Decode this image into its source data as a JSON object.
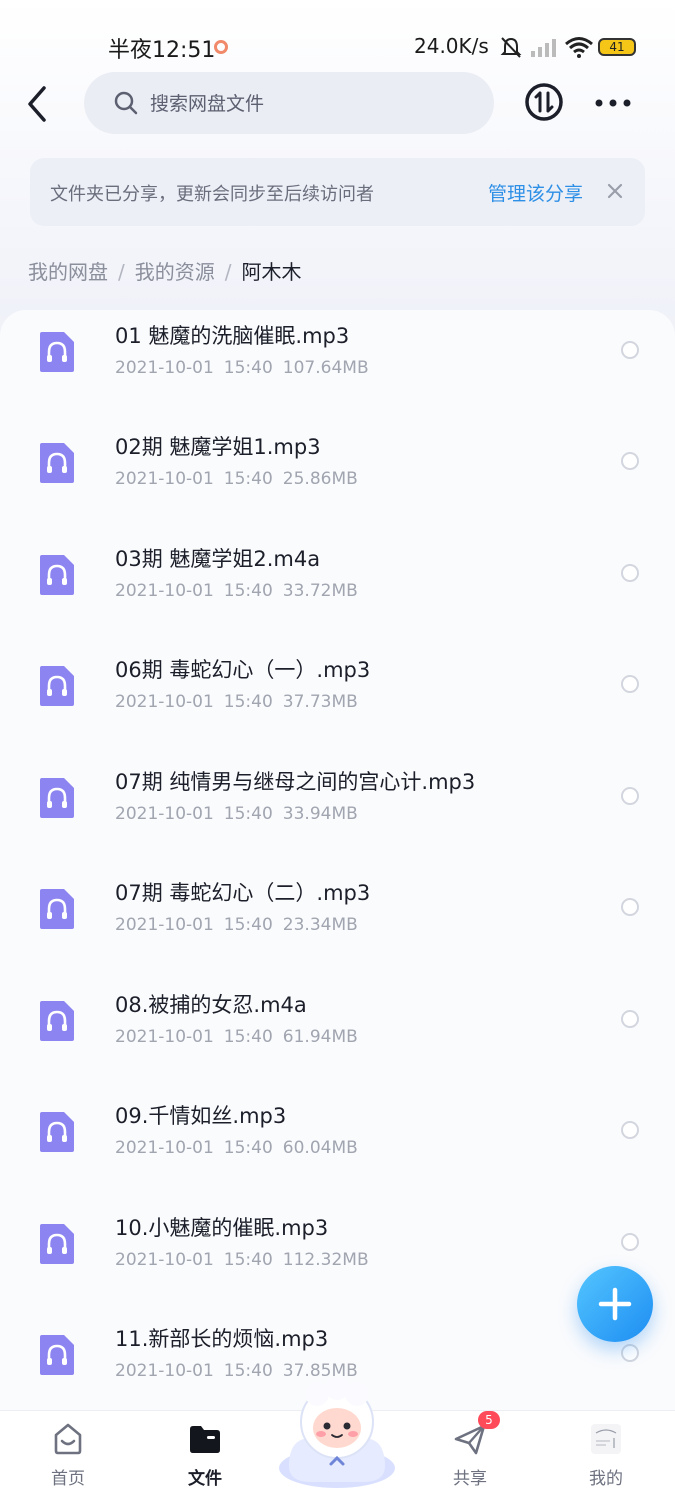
{
  "status_bar": {
    "time": "半夜12:51",
    "net_speed": "24.0K/s",
    "battery": "41"
  },
  "header": {
    "search_placeholder": "搜索网盘文件",
    "icons": [
      "back-arrow-icon",
      "search-icon",
      "transfer-icon",
      "more-icon"
    ]
  },
  "notice": {
    "text": "文件夹已分享，更新会同步至后续访问者",
    "link": "管理该分享"
  },
  "breadcrumb": {
    "items": [
      "我的网盘",
      "我的资源"
    ],
    "current": "阿木木"
  },
  "files": [
    {
      "name": "01 魅魔的洗脑催眠.mp3",
      "date": "2021-10-01",
      "time": "15:40",
      "size": "107.64MB"
    },
    {
      "name": "02期 魅魔学姐1.mp3",
      "date": "2021-10-01",
      "time": "15:40",
      "size": "25.86MB"
    },
    {
      "name": "03期 魅魔学姐2.m4a",
      "date": "2021-10-01",
      "time": "15:40",
      "size": "33.72MB"
    },
    {
      "name": "06期 毒蛇幻心（一）.mp3",
      "date": "2021-10-01",
      "time": "15:40",
      "size": "37.73MB"
    },
    {
      "name": "07期 纯情男与继母之间的宫心计.mp3",
      "date": "2021-10-01",
      "time": "15:40",
      "size": "33.94MB"
    },
    {
      "name": "07期 毒蛇幻心（二）.mp3",
      "date": "2021-10-01",
      "time": "15:40",
      "size": "23.34MB"
    },
    {
      "name": "08.被捕的女忍.m4a",
      "date": "2021-10-01",
      "time": "15:40",
      "size": "61.94MB"
    },
    {
      "name": "09.千情如丝.mp3",
      "date": "2021-10-01",
      "time": "15:40",
      "size": "60.04MB"
    },
    {
      "name": "10.小魅魔的催眠.mp3",
      "date": "2021-10-01",
      "time": "15:40",
      "size": "112.32MB"
    },
    {
      "name": "11.新部长的烦恼.mp3",
      "date": "2021-10-01",
      "time": "15:40",
      "size": "37.85MB"
    }
  ],
  "nav": {
    "home": "首页",
    "files": "文件",
    "share": "共享",
    "share_badge": "5",
    "mine": "我的"
  },
  "colors": {
    "accent": "#2e8fe6",
    "file_icon": "#8c84f0",
    "badge": "#ff4a5a"
  }
}
